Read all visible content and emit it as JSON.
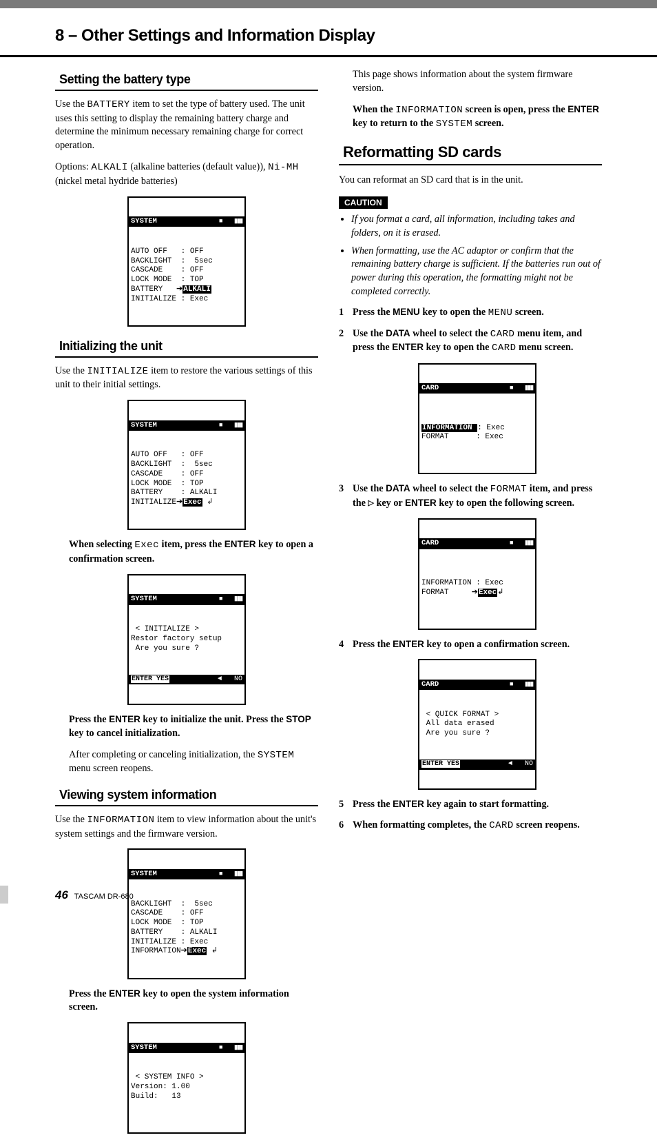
{
  "chapter_title": "8 – Other Settings and Information Display",
  "left": {
    "sec1": {
      "head": "Setting the battery type",
      "p1a": "Use the ",
      "p1b": " item to set the type of battery used. The unit uses this setting to display the remaining battery charge and determine the minimum necessary remaining charge for correct operation.",
      "p2a": "Options: ",
      "p2b": " (alkaline batteries (default value)), ",
      "p2c": " (nickel metal hydride batteries)",
      "mono": {
        "battery": "BATTERY",
        "alkali": "ALKALI",
        "nimh": "Ni-MH"
      },
      "lcd_title": "SYSTEM",
      "lcd_body": "AUTO OFF   : OFF\nBACKLIGHT  :  5sec\nCASCADE    : OFF\nLOCK MODE  : TOP\nBATTERY   ➔",
      "lcd_sel": "ALKALI",
      "lcd_body2": "\nINITIALIZE : Exec"
    },
    "sec2": {
      "head": "Initializing the unit",
      "p1a": "Use the ",
      "p1b": " item to restore the various settings of this unit to their initial settings.",
      "mono": {
        "initialize": "INITIALIZE",
        "exec": "Exec",
        "system": "SYSTEM"
      },
      "lcd_title": "SYSTEM",
      "lcd_body": "AUTO OFF   : OFF\nBACKLIGHT  :  5sec\nCASCADE    : OFF\nLOCK MODE  : TOP\nBATTERY    : ALKALI\nINITIALIZE➔",
      "lcd_sel": "Exec",
      "lcd_body2": " ↲",
      "p2a": "When selecting ",
      "p2b": " item, press the ",
      "p2c": " key to open a confirmation screen.",
      "key_enter": "ENTER",
      "lcd2_title": "SYSTEM",
      "lcd2_body": " < INITIALIZE >\nRestor factory setup\n Are you sure ?",
      "lcd2_foot_left": "ENTER YES",
      "lcd2_foot_right": "◄   NO",
      "p3a": "Press the ",
      "p3b": " key to initialize the unit. Press the ",
      "p3c": " key to cancel initialization.",
      "key_stop": "STOP",
      "p4a": "After completing or canceling initialization, the ",
      "p4b": " menu screen reopens."
    },
    "sec3": {
      "head": "Viewing system information",
      "p1a": "Use the ",
      "p1b": " item to view information about the unit's system settings and the firmware version.",
      "mono": {
        "information": "INFORMATION"
      },
      "lcd_title": "SYSTEM",
      "lcd_body": "BACKLIGHT  :  5sec\nCASCADE    : OFF\nLOCK MODE  : TOP\nBATTERY    : ALKALI\nINITIALIZE : Exec\nINFORMATION➔",
      "lcd_sel": "Exec",
      "lcd_body2": " ↲",
      "p2a": "Press the ",
      "p2b": " key to open the system information screen.",
      "key_enter": "ENTER",
      "lcd2_title": "SYSTEM",
      "lcd2_body": " < SYSTEM INFO >\nVersion: 1.00\nBuild:   13\n\n"
    }
  },
  "right": {
    "p1": "This page shows information about the system firmware version.",
    "p2a": "When the ",
    "p2b": " screen is open, press the ",
    "p2c": " key to return to the ",
    "p2d": " screen.",
    "mono": {
      "information": "INFORMATION",
      "system": "SYSTEM",
      "menu": "MENU",
      "card": "CARD",
      "format": "FORMAT"
    },
    "key_enter": "ENTER",
    "sec1": {
      "head": "Reformatting SD cards",
      "p1": "You can reformat an SD card that is in the unit.",
      "caution": "CAUTION",
      "b1": "If you format a card, all information, including takes and folders, on it is erased.",
      "b2": "When formatting, use the AC adaptor or confirm that the remaining battery charge is sufficient. If the batteries run out of power during this operation, the formatting might not be completed correctly.",
      "s1a": "Press the ",
      "s1b": " key to open the ",
      "s1c": " screen.",
      "key_menu": "MENU",
      "s2a": "Use the ",
      "s2b": " wheel to select the ",
      "s2c": " menu item, and press the ",
      "s2d": " key to open the ",
      "s2e": " menu screen.",
      "key_data": "DATA",
      "lcd1_title": "CARD",
      "lcd1_body_pre": "\n",
      "lcd1_sel": "INFORMATION ",
      "lcd1_body": ": Exec\nFORMAT      : Exec\n\n",
      "s3a": "Use the ",
      "s3b": " wheel to select the ",
      "s3c": " item, and press the ",
      "s3d": " key or ",
      "s3e": " key to open the following screen.",
      "lcd2_title": "CARD",
      "lcd2_body": "\nINFORMATION : Exec\nFORMAT     ➔",
      "lcd2_sel": "Exec",
      "lcd2_body2": "↲\n\n",
      "s4a": "Press the ",
      "s4b": " key to open a confirmation screen.",
      "lcd3_title": "CARD",
      "lcd3_body": " < QUICK FORMAT >\n All data erased\n Are you sure ?",
      "lcd3_foot_left": "ENTER YES",
      "lcd3_foot_right": "◄   NO",
      "s5a": "Press the ",
      "s5b": " key again to start formatting.",
      "s6a": "When formatting completes, the ",
      "s6b": " screen reopens."
    }
  },
  "footer": {
    "page": "46",
    "model": "TASCAM  DR-680"
  }
}
